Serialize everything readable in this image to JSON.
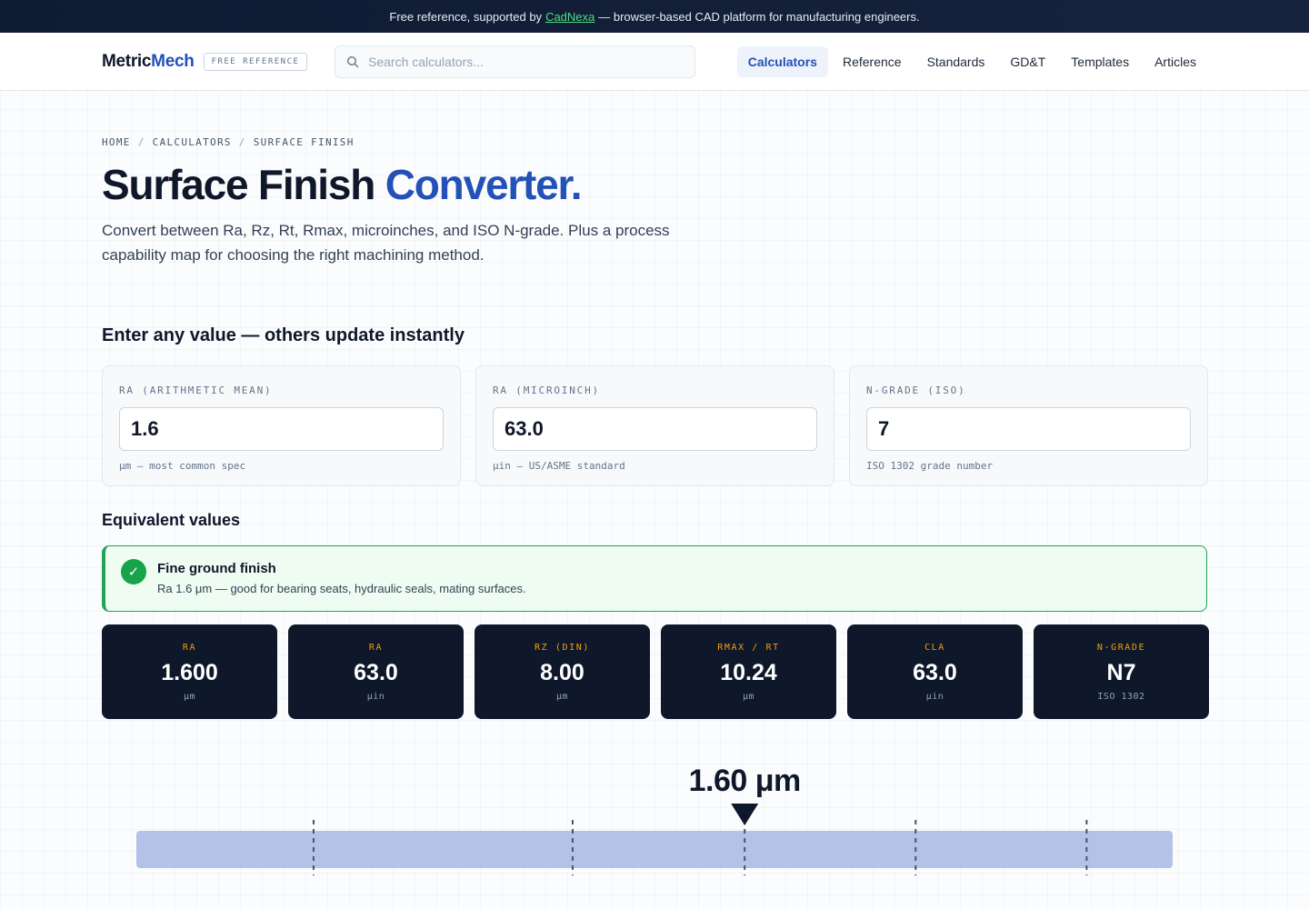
{
  "banner": {
    "text_before": "Free reference, supported by",
    "link": "CadNexa",
    "text_after": "— browser-based CAD platform for manufacturing engineers."
  },
  "header": {
    "brand_part1": "Metric",
    "brand_part2": "Mech",
    "badge": "FREE REFERENCE",
    "search_placeholder": "Search calculators...",
    "nav": [
      "Calculators",
      "Reference",
      "Standards",
      "GD&T",
      "Templates",
      "Articles"
    ],
    "active_nav": "Calculators"
  },
  "breadcrumb": [
    "HOME",
    "CALCULATORS",
    "SURFACE FINISH"
  ],
  "page": {
    "title_main": "Surface Finish",
    "title_accent": "Converter.",
    "lede": "Convert between Ra, Rz, Rt, Rmax, microinches, and ISO N-grade. Plus a process capability map for choosing the right machining method.",
    "inputs_heading": "Enter any value — others update instantly",
    "equiv_heading": "Equivalent values"
  },
  "inputs": [
    {
      "label": "RA (ARITHMETIC MEAN)",
      "value": "1.6",
      "hint": "μm — most common spec"
    },
    {
      "label": "RA (MICROINCH)",
      "value": "63.0",
      "hint": "μin — US/ASME standard"
    },
    {
      "label": "N-GRADE (ISO)",
      "value": "7",
      "hint": "ISO 1302 grade number"
    }
  ],
  "status": {
    "title": "Fine ground finish",
    "description": "Ra 1.6 μm — good for bearing seats, hydraulic seals, mating surfaces.",
    "color": "#16a34a"
  },
  "results": [
    {
      "label": "RA",
      "value": "1.600",
      "unit": "μm"
    },
    {
      "label": "RA",
      "value": "63.0",
      "unit": "μin"
    },
    {
      "label": "RZ (DIN)",
      "value": "8.00",
      "unit": "μm"
    },
    {
      "label": "RMAX / RT",
      "value": "10.24",
      "unit": "μm"
    },
    {
      "label": "CLA",
      "value": "63.0",
      "unit": "μin"
    },
    {
      "label": "N-GRADE",
      "value": "N7",
      "unit": "ISO 1302"
    }
  ],
  "scale": {
    "marker_label": "1.60 μm",
    "marker_fraction": 0.587,
    "tick_fractions": [
      0.171,
      0.421,
      0.587,
      0.752,
      0.917
    ],
    "bar_color": "#b3c3e8"
  },
  "colors": {
    "accent": "#2451b7",
    "dark_card": "#0f172a",
    "label_amber": "#f59e0b"
  }
}
